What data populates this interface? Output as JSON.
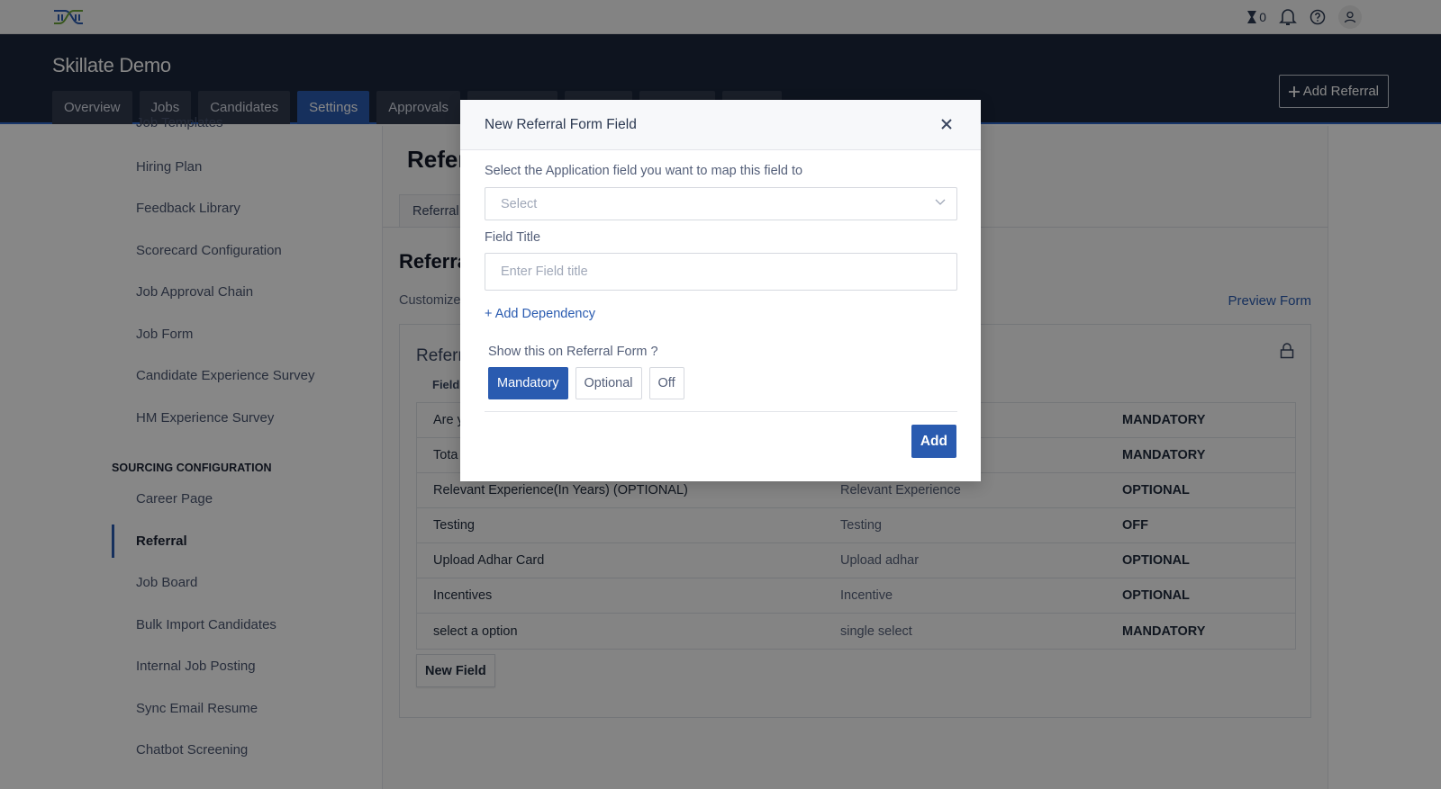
{
  "topbar": {
    "logo": "skillate-logo",
    "pending_count": "0",
    "icons": [
      "hourglass-icon",
      "bell-icon",
      "help-icon",
      "user-avatar-icon"
    ]
  },
  "header": {
    "org_title": "Skillate Demo",
    "tabs": [
      {
        "label": "Overview",
        "active": false
      },
      {
        "label": "Jobs",
        "active": false
      },
      {
        "label": "Candidates",
        "active": false
      },
      {
        "label": "Settings",
        "active": true
      },
      {
        "label": "Approvals",
        "active": false
      }
    ],
    "add_referral_label": "Add Referral"
  },
  "sidebar": {
    "items_top": [
      {
        "label": "Job Templates"
      },
      {
        "label": "Hiring Plan"
      },
      {
        "label": "Feedback Library"
      },
      {
        "label": "Scorecard Configuration"
      },
      {
        "label": "Job Approval Chain"
      },
      {
        "label": "Job Form"
      },
      {
        "label": "Candidate Experience Survey"
      },
      {
        "label": "HM Experience Survey"
      }
    ],
    "section_heading": "SOURCING CONFIGURATION",
    "items_sourcing": [
      {
        "label": "Career Page",
        "active": false
      },
      {
        "label": "Referral",
        "active": true
      },
      {
        "label": "Job Board",
        "active": false
      },
      {
        "label": "Bulk Import Candidates",
        "active": false
      },
      {
        "label": "Internal Job Posting",
        "active": false
      },
      {
        "label": "Sync Email Resume",
        "active": false
      },
      {
        "label": "Chatbot Screening",
        "active": false
      }
    ]
  },
  "main": {
    "title": "Refer",
    "subtab": "Referral",
    "section_title": "Referra",
    "section_desc": "Customize",
    "preview_link": "Preview Form",
    "card_title": "Referr",
    "column_header": "Field",
    "rows": [
      {
        "field": "Are y",
        "mapped": "",
        "status": "MANDATORY"
      },
      {
        "field": "Tota",
        "mapped": "",
        "status": "MANDATORY"
      },
      {
        "field": "Relevant Experience(In Years) (OPTIONAL)",
        "mapped": "Relevant Experience",
        "status": "OPTIONAL"
      },
      {
        "field": "Testing",
        "mapped": "Testing",
        "status": "OFF"
      },
      {
        "field": "Upload Adhar Card",
        "mapped": "Upload adhar",
        "status": "OPTIONAL"
      },
      {
        "field": "Incentives",
        "mapped": "Incentive",
        "status": "OPTIONAL"
      },
      {
        "field": "select a option",
        "mapped": "single select",
        "status": "MANDATORY"
      }
    ],
    "new_field_label": "New Field"
  },
  "modal": {
    "title": "New Referral Form Field",
    "map_label": "Select the Application field you want to map this field to",
    "select_placeholder": "Select",
    "field_title_label": "Field Title",
    "field_title_placeholder": "Enter Field title",
    "field_title_value": "",
    "add_dependency_label": "+ Add Dependency",
    "show_label": "Show this on Referral Form ?",
    "options": [
      {
        "label": "Mandatory",
        "active": true
      },
      {
        "label": "Optional",
        "active": false
      },
      {
        "label": "Off",
        "active": false
      }
    ],
    "add_label": "Add"
  },
  "colors": {
    "accent": "#2a5bb0",
    "header_bg": "#1c273b",
    "tab_bg": "#313b4f"
  }
}
